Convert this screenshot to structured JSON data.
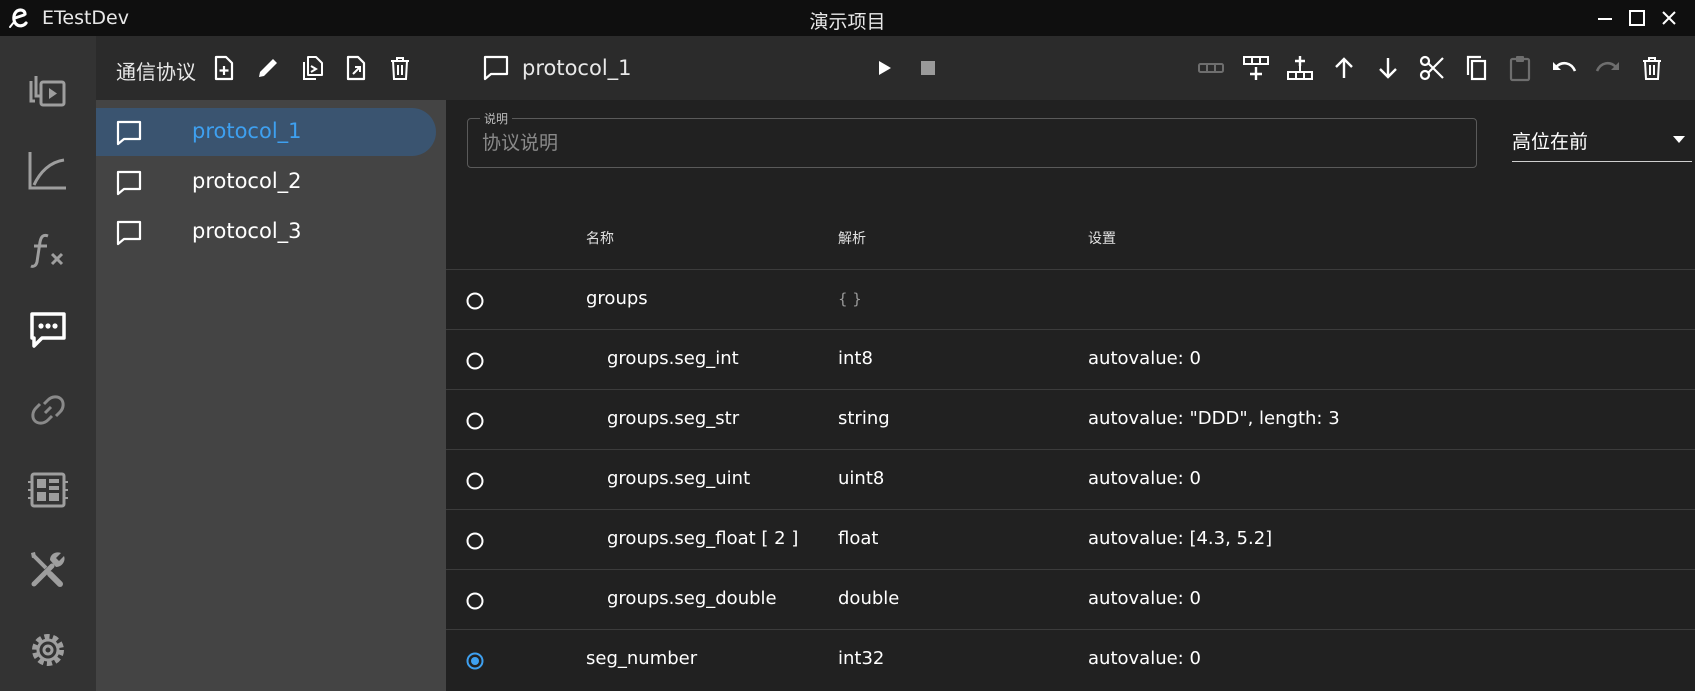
{
  "window": {
    "app_name": "ETestDev",
    "title": "演示项目"
  },
  "sidebar": {
    "items": [
      {
        "icon": "layers-play-icon"
      },
      {
        "icon": "chart-line-icon"
      },
      {
        "icon": "function-icon"
      },
      {
        "icon": "message-protocol-icon"
      },
      {
        "icon": "link-icon"
      },
      {
        "icon": "board-icon"
      },
      {
        "icon": "tools-icon"
      },
      {
        "icon": "settings-icon"
      }
    ]
  },
  "protocols": {
    "header": "通信协议",
    "items": [
      {
        "label": "protocol_1"
      },
      {
        "label": "protocol_2"
      },
      {
        "label": "protocol_3"
      }
    ]
  },
  "main": {
    "title": "protocol_1",
    "description": {
      "label": "说明",
      "placeholder": "协议说明",
      "value": ""
    },
    "byte_order": "高位在前",
    "columns": {
      "name": "名称",
      "parse": "解析",
      "settings": "设置"
    },
    "rows": [
      {
        "name": "groups",
        "parse": "{ }",
        "settings": ""
      },
      {
        "name": "groups.seg_int",
        "parse": "int8",
        "settings": "autovalue: 0"
      },
      {
        "name": "groups.seg_str",
        "parse": "string",
        "settings": "autovalue: \"DDD\", length: 3"
      },
      {
        "name": "groups.seg_uint",
        "parse": "uint8",
        "settings": "autovalue: 0"
      },
      {
        "name": "groups.seg_float [ 2 ]",
        "parse": "float",
        "settings": "autovalue: [4.3, 5.2]"
      },
      {
        "name": "groups.seg_double",
        "parse": "double",
        "settings": "autovalue: 0"
      },
      {
        "name": "seg_number",
        "parse": "int32",
        "settings": "autovalue: 0"
      }
    ],
    "selected_row": "seg_number"
  },
  "colors": {
    "accent": "#3ea0f0",
    "selected_item_bg": "#3a5470"
  }
}
